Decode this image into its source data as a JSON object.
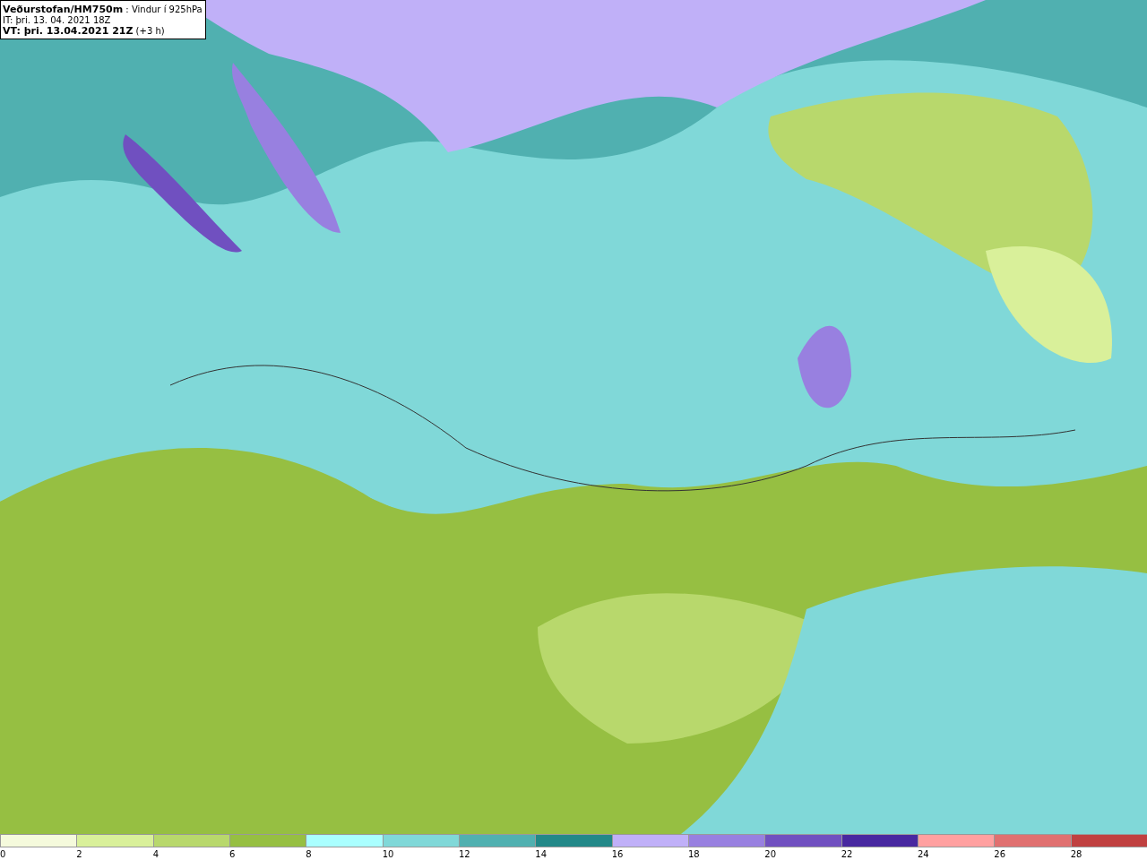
{
  "title_box": {
    "lines": [
      "**Veðurstofan/HM750m** : Vindur í 925hPa",
      "IT: þri. 13. 04. 2021 18Z",
      "**VT: þri. 13.04.2021 21Z** (+3 h)"
    ]
  },
  "legend": [
    {
      "label": "0",
      "color": "#f5fadc"
    },
    {
      "label": "2",
      "color": "#d9f09a"
    },
    {
      "label": "4",
      "color": "#b8d86c"
    },
    {
      "label": "6",
      "color": "#96bf42"
    },
    {
      "label": "8",
      "color": "#aaffff"
    },
    {
      "label": "10",
      "color": "#80d8d8"
    },
    {
      "label": "12",
      "color": "#50b0b0"
    },
    {
      "label": "14",
      "color": "#228888"
    },
    {
      "label": "16",
      "color": "#c0b0f8"
    },
    {
      "label": "18",
      "color": "#9880e0"
    },
    {
      "label": "20",
      "color": "#7050c0"
    },
    {
      "label": "22",
      "color": "#4828a0"
    },
    {
      "label": "24",
      "color": "#ffa0a0"
    },
    {
      "label": "26",
      "color": "#e07070"
    },
    {
      "label": "28",
      "color": "#c04040"
    }
  ]
}
